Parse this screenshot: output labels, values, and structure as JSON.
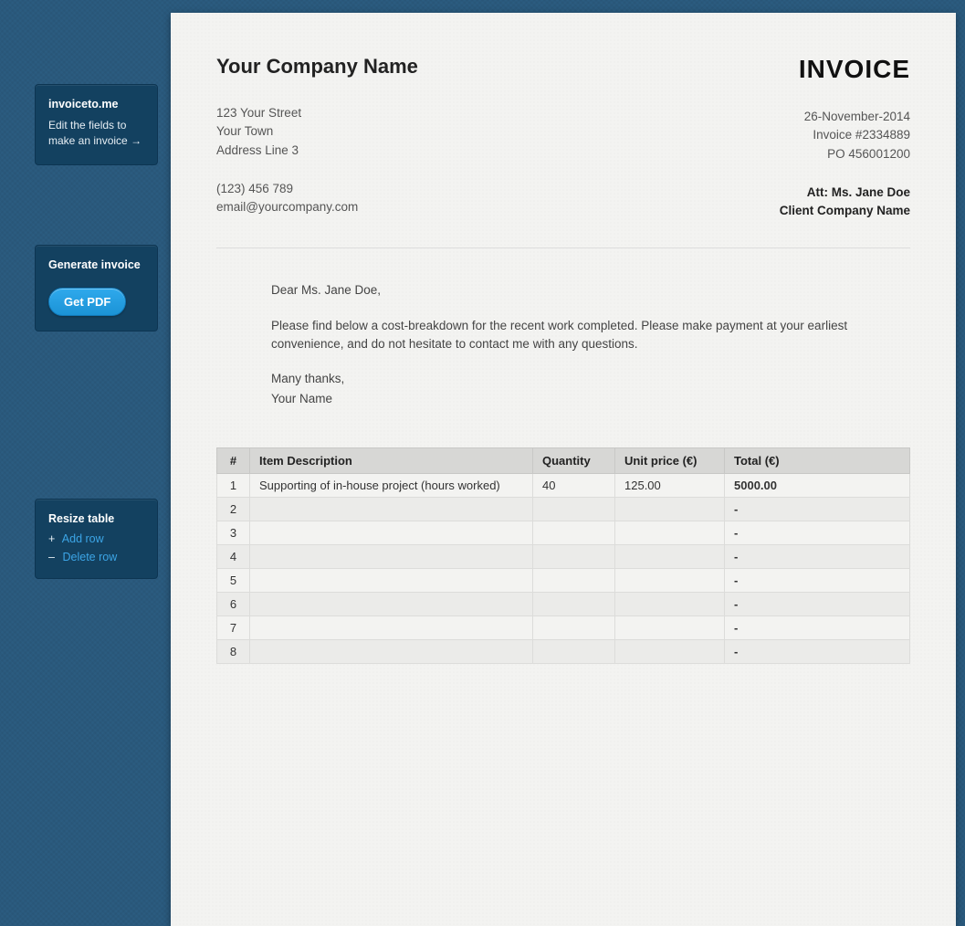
{
  "sidebars": {
    "intro": {
      "title": "invoiceto.me",
      "body_line1": "Edit the fields to",
      "body_line2": "make an invoice",
      "arrow": "→"
    },
    "generate": {
      "title": "Generate invoice",
      "button": "Get PDF"
    },
    "resize": {
      "title": "Resize table",
      "add_sign": "+",
      "add_label": "Add row",
      "del_sign": "–",
      "del_label": "Delete row"
    }
  },
  "invoice": {
    "company": {
      "name": "Your Company Name",
      "addr1": "123 Your Street",
      "addr2": "Your Town",
      "addr3": "Address Line 3",
      "phone": "(123) 456 789",
      "email": "email@yourcompany.com"
    },
    "header": {
      "title": "INVOICE",
      "date": "26-November-2014",
      "invoice_no": "Invoice #2334889",
      "po_no": "PO 456001200",
      "att": "Att: Ms. Jane Doe",
      "client": "Client Company Name"
    },
    "letter": {
      "greeting": "Dear Ms. Jane Doe,",
      "body": "Please find below a cost-breakdown for the recent work completed. Please make payment at your earliest convenience, and do not hesitate to contact me with any questions.",
      "signoff": "Many thanks,",
      "name": "Your Name"
    },
    "table": {
      "headers": {
        "num": "#",
        "desc": "Item Description",
        "qty": "Quantity",
        "unit": "Unit price (€)",
        "total": "Total (€)"
      },
      "rows": [
        {
          "n": "1",
          "desc": "Supporting of in-house project (hours worked)",
          "qty": "40",
          "unit": "125.00",
          "total": "5000.00"
        },
        {
          "n": "2",
          "desc": "",
          "qty": "",
          "unit": "",
          "total": "-"
        },
        {
          "n": "3",
          "desc": "",
          "qty": "",
          "unit": "",
          "total": "-"
        },
        {
          "n": "4",
          "desc": "",
          "qty": "",
          "unit": "",
          "total": "-"
        },
        {
          "n": "5",
          "desc": "",
          "qty": "",
          "unit": "",
          "total": "-"
        },
        {
          "n": "6",
          "desc": "",
          "qty": "",
          "unit": "",
          "total": "-"
        },
        {
          "n": "7",
          "desc": "",
          "qty": "",
          "unit": "",
          "total": "-"
        },
        {
          "n": "8",
          "desc": "",
          "qty": "",
          "unit": "",
          "total": "-"
        }
      ]
    }
  }
}
